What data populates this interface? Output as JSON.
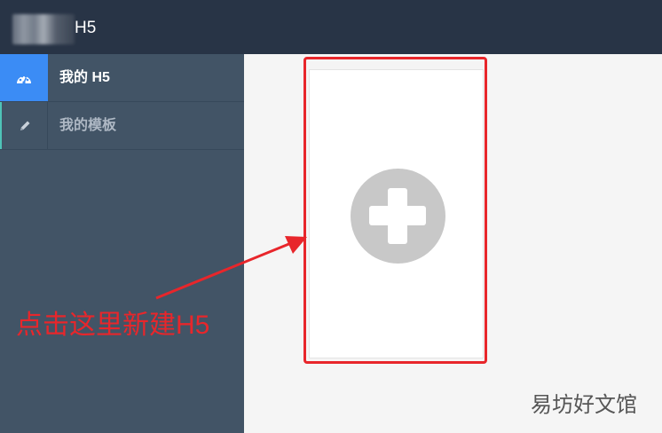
{
  "header": {
    "title": "H5"
  },
  "sidebar": {
    "items": [
      {
        "label": "我的 H5",
        "icon": "dashboard-icon",
        "active": true
      },
      {
        "label": "我的模板",
        "icon": "pencil-icon",
        "active": false
      }
    ]
  },
  "annotation": {
    "text": "点击这里新建H5"
  },
  "watermark": {
    "text": "易坊好文馆"
  },
  "colors": {
    "accent": "#3b8cf5",
    "header_bg": "#283446",
    "sidebar_bg": "#425466",
    "highlight": "#e8262b"
  }
}
